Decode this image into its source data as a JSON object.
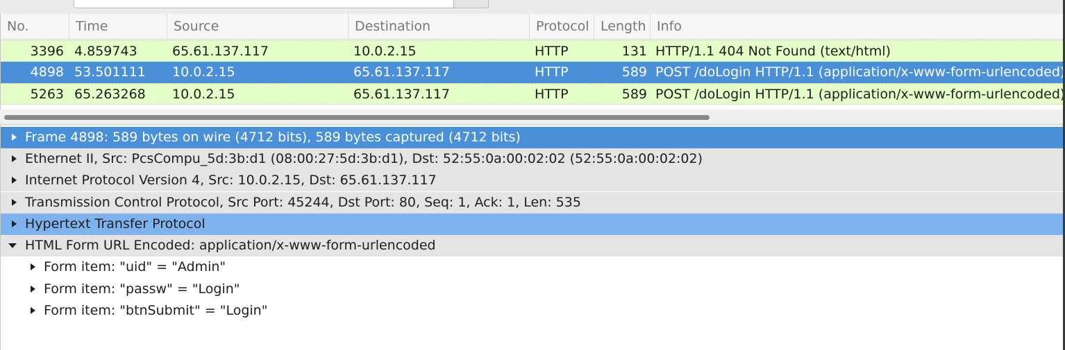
{
  "packet_list": {
    "columns": [
      "No.",
      "Time",
      "Source",
      "Destination",
      "Protocol",
      "Length",
      "Info"
    ],
    "rows": [
      {
        "no": "3396",
        "time": "4.859743",
        "source": "65.61.137.117",
        "destination": "10.0.2.15",
        "protocol": "HTTP",
        "length": "131",
        "info": "HTTP/1.1 404 Not Found  (text/html)"
      },
      {
        "no": "4898",
        "time": "53.501111",
        "source": "10.0.2.15",
        "destination": "65.61.137.117",
        "protocol": "HTTP",
        "length": "589",
        "info": "POST /doLogin HTTP/1.1  (application/x-www-form-urlencoded)"
      },
      {
        "no": "5263",
        "time": "65.263268",
        "source": "10.0.2.15",
        "destination": "65.61.137.117",
        "protocol": "HTTP",
        "length": "589",
        "info": "POST /doLogin HTTP/1.1  (application/x-www-form-urlencoded)"
      }
    ]
  },
  "details": {
    "items": [
      {
        "text": "Frame 4898: 589 bytes on wire (4712 bits), 589 bytes captured (4712 bits)",
        "expanded": false
      },
      {
        "text": "Ethernet II, Src: PcsCompu_5d:3b:d1 (08:00:27:5d:3b:d1), Dst: 52:55:0a:00:02:02 (52:55:0a:00:02:02)",
        "expanded": false
      },
      {
        "text": "Internet Protocol Version 4, Src: 10.0.2.15, Dst: 65.61.137.117",
        "expanded": false
      },
      {
        "text": "Transmission Control Protocol, Src Port: 45244, Dst Port: 80, Seq: 1, Ack: 1, Len: 535",
        "expanded": false
      },
      {
        "text": "Hypertext Transfer Protocol",
        "expanded": false
      },
      {
        "text": "HTML Form URL Encoded: application/x-www-form-urlencoded",
        "expanded": true
      },
      {
        "text": "Form item: \"uid\" = \"Admin\"",
        "expanded": false
      },
      {
        "text": "Form item: \"passw\" = \"Login\"",
        "expanded": false
      },
      {
        "text": "Form item: \"btnSubmit\" = \"Login\"",
        "expanded": false
      }
    ]
  },
  "colors": {
    "http_row": "#e4ffc7",
    "selected": "#4a90d9",
    "hover": "#7fb3ee"
  }
}
